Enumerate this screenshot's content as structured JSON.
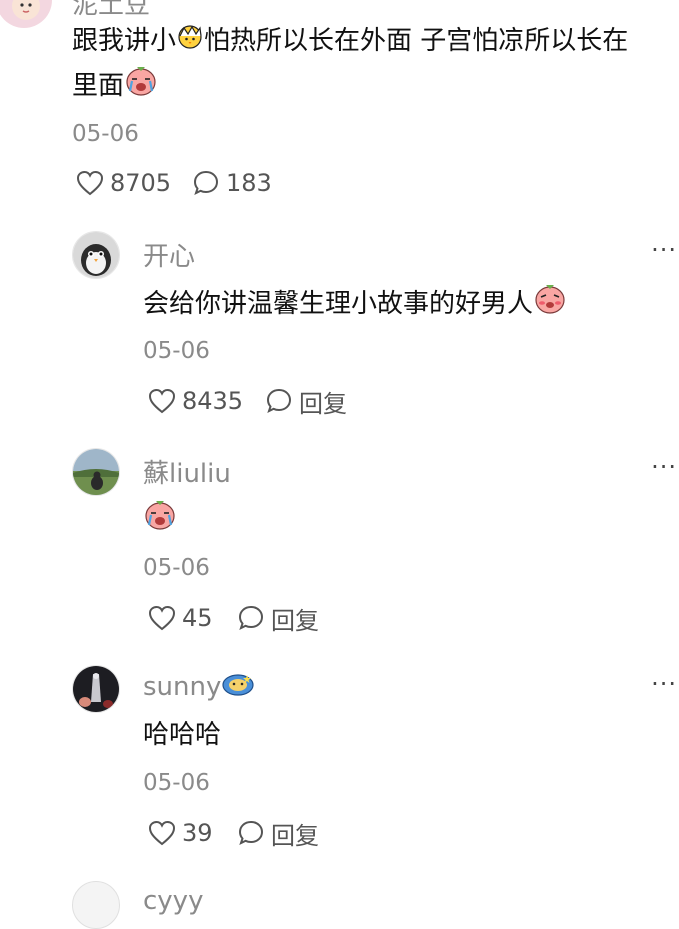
{
  "top_comment": {
    "username": "泥土豆",
    "text_part1": "跟我讲小",
    "text_part2": "怕热所以长在外面 子宫怕凉所以长在",
    "text_part3": "里面",
    "date": "05-06",
    "likes": "8705",
    "replies": "183"
  },
  "replies": [
    {
      "username": "开心",
      "text": "会给你讲温馨生理小故事的好男人",
      "date": "05-06",
      "likes": "8435",
      "reply_label": "回复"
    },
    {
      "username": "蘇liuliu",
      "text": "",
      "date": "05-06",
      "likes": "45",
      "reply_label": "回复"
    },
    {
      "username": "sunny",
      "text": "哈哈哈",
      "date": "05-06",
      "likes": "39",
      "reply_label": "回复"
    },
    {
      "username": "cyyy"
    }
  ],
  "more_label": "···",
  "colors": {
    "meta_gray": "#8a8a8a",
    "text": "#111111"
  }
}
